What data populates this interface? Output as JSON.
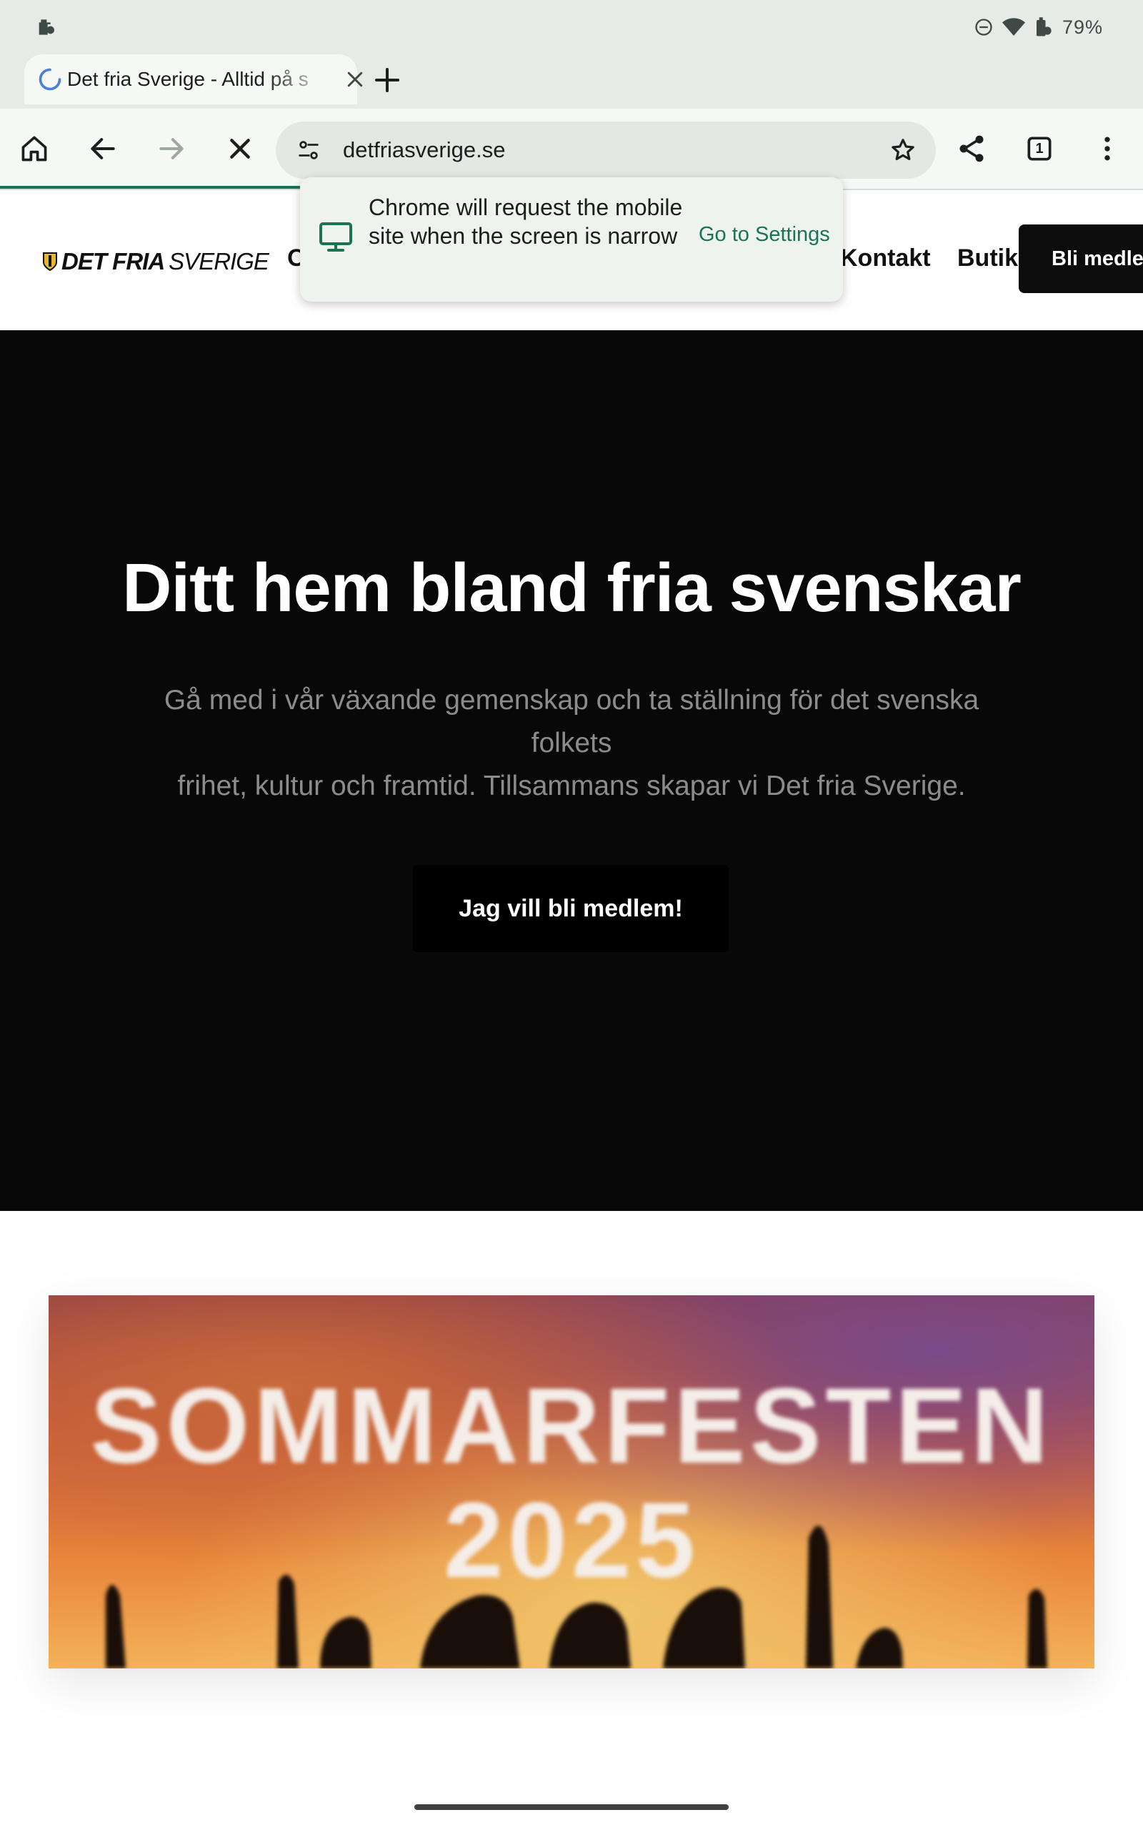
{
  "status_bar": {
    "battery": "79%"
  },
  "browser": {
    "tab": {
      "title": "Det fria Sverige - Alltid på s"
    },
    "omnibox": {
      "url": "detfriasverige.se"
    },
    "tab_count": "1"
  },
  "popup": {
    "message": "Chrome will request the mobile site when the screen is narrow",
    "link": "Go to Settings"
  },
  "site": {
    "logo_bold": "DET FRIA",
    "logo_light": "SVERIGE",
    "nav": {
      "partial": "O",
      "kontakt": "Kontakt",
      "butik": "Butik",
      "join": "Bli medle"
    },
    "hero": {
      "title": "Ditt hem bland fria svenskar",
      "subtitle_line1": "Gå med i vår växande gemenskap och ta ställning för det svenska folkets",
      "subtitle_line2": "frihet,  kultur och framtid. Tillsammans skapar vi Det fria Sverige.",
      "cta": "Jag vill bli medlem!"
    },
    "banner": {
      "title": "SOMMARFESTEN",
      "year": "2025"
    }
  },
  "colors": {
    "accent_green": "#1b7352",
    "hero_bg": "#080808",
    "chrome_bg": "#e6ebe8"
  }
}
